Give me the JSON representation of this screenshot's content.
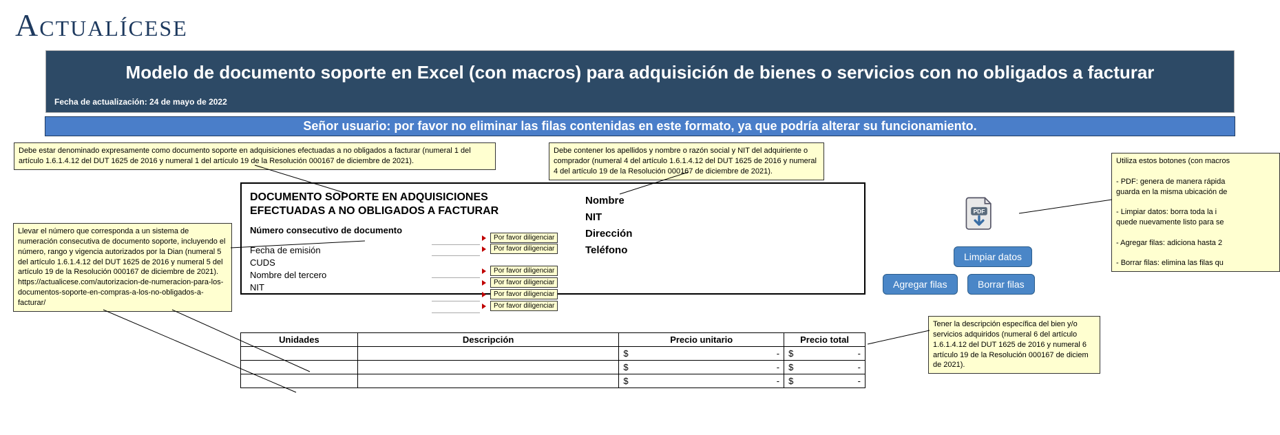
{
  "brand": "Actualícese",
  "title": "Modelo de documento soporte en Excel (con macros) para adquisición de bienes o servicios con no obligados a facturar",
  "update_label": "Fecha de actualización: 24 de mayo de 2022",
  "warning": "Señor usuario: por favor no eliminar las filas contenidas en este formato, ya que podría alterar su funcionamiento.",
  "notes": {
    "top_left": "Debe estar denominado expresamente como documento soporte en adquisiciones efectuadas a no obligados a facturar (numeral 1 del artículo 1.6.1.4.12 del DUT 1625 de 2016 y numeral 1 del artículo 19 de la Resolución 000167 de diciembre de 2021).",
    "top_right": "Debe contener los apellidos y nombre o razón social y NIT del adquiriente o comprador (numeral 4 del artículo 1.6.1.4.12 del DUT 1625 de 2016 y numeral 4 del artículo 19 de la Resolución 000167 de diciembre de 2021).",
    "left": "Llevar el número que corresponda a un sistema de numeración consecutiva de documento soporte, incluyendo el número, rango y vigencia autorizados por la Dian (numeral 5 del artículo 1.6.1.4.12 del DUT 1625 de 2016 y numeral 5 del artículo 19 de la Resolución 000167 de diciembre de 2021).\nhttps://actualicese.com/autorizacion-de-numeracion-para-los-documentos-soporte-en-compras-a-los-no-obligados-a-facturar/",
    "right_buttons": "Utiliza estos botones (con macros\n\n- PDF: genera de manera rápida\nguarda en la misma ubicación de\n\n- Limpiar datos: borra toda la i\nquede nuevamente listo para se\n\n- Agregar filas: adiciona hasta 2\n\n- Borrar filas: elimina las filas qu",
    "right_desc": "Tener la descripción específica del bien y/o servicios adquiridos (numeral 6 del artículo 1.6.1.4.12 del DUT 1625 de 2016 y numeral 6 artículo 19 de la Resolución 000167 de diciem de 2021)."
  },
  "doc": {
    "heading1": "DOCUMENTO SOPORTE EN ADQUISICIONES",
    "heading2": "EFECTUADAS A NO OBLIGADOS A FACTURAR",
    "num_label": "Número consecutivo de documento",
    "fields": {
      "fecha": "Fecha de emisión",
      "cuds": "CUDS",
      "tercero": "Nombre del tercero",
      "nit": "NIT"
    },
    "hint": "Por favor diligenciar"
  },
  "buyer": {
    "nombre": "Nombre",
    "nit": "NIT",
    "direccion": "Dirección",
    "telefono": "Teléfono"
  },
  "buttons": {
    "limpiar": "Limpiar datos",
    "agregar": "Agregar filas",
    "borrar": "Borrar filas"
  },
  "table": {
    "headers": [
      "Unidades",
      "Descripción",
      "Precio unitario",
      "Precio total"
    ],
    "currency": "$",
    "dash": "-"
  }
}
